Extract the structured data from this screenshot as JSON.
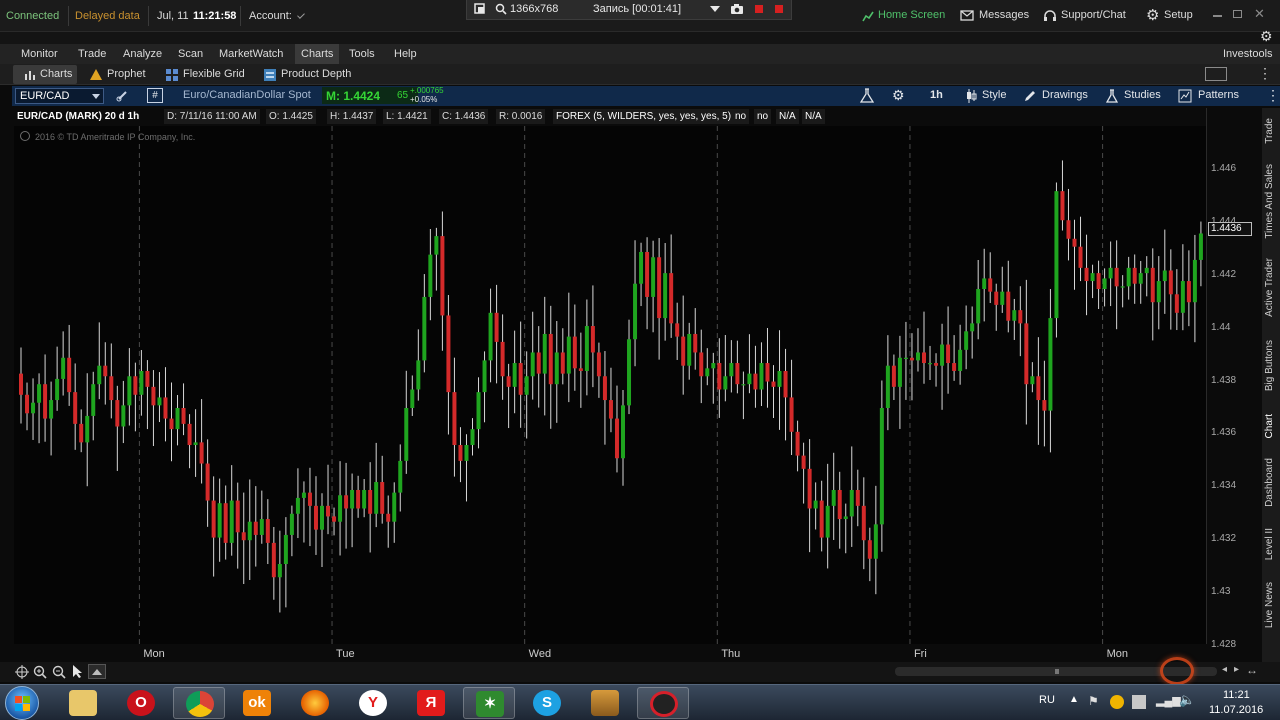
{
  "status": {
    "connected": "Connected",
    "delayed": "Delayed data",
    "date": "Jul, 11",
    "time": "11:21:58",
    "account_label": "Account:"
  },
  "recorder": {
    "resolution": "1366x768",
    "recording": "Запись [00:01:41]"
  },
  "top_right": {
    "home": "Home Screen",
    "messages": "Messages",
    "support": "Support/Chat",
    "setup": "Setup"
  },
  "menu": [
    "Monitor",
    "Trade",
    "Analyze",
    "Scan",
    "MarketWatch",
    "Charts",
    "Tools",
    "Help"
  ],
  "menu_right": "Investools",
  "subtabs": [
    "Charts",
    "Prophet",
    "Flexible Grid",
    "Product Depth"
  ],
  "chart_toolbar": {
    "symbol": "EUR/CAD",
    "description": "Euro/CanadianDollar Spot",
    "mark_label": "M: 1.4424",
    "mark_suffix": "65",
    "change": "+.000765",
    "change_pct": "+0.05%",
    "timeframe": "1h",
    "style": "Style",
    "drawings": "Drawings",
    "studies": "Studies",
    "patterns": "Patterns"
  },
  "info": {
    "title": "EUR/CAD (MARK) 20 d 1h",
    "date": "D: 7/11/16 11:00 AM",
    "open": "O: 1.4425",
    "high": "H: 1.4437",
    "low": "L: 1.4421",
    "close": "C: 1.4436",
    "range": "R: 0.0016",
    "forex": "FOREX (5, WILDERS, yes, yes, yes, 5)",
    "f1": "no",
    "f2": "no",
    "f3": "N/A",
    "f4": "N/A"
  },
  "copyright": "2016 © TD Ameritrade IP Company, Inc.",
  "last_price_tag": "1.4436",
  "colors": {
    "up": "#1fa51f",
    "down": "#d42a2a",
    "toolbar": "#10294a",
    "accent_green": "#28c828"
  },
  "side_tabs": [
    "Trade",
    "Times And Sales",
    "Active Trader",
    "Big Buttons",
    "Chart",
    "Dashboard",
    "Level II",
    "Live News"
  ],
  "system_tray": {
    "lang": "RU",
    "clock": "11:21",
    "date": "11.07.2016"
  },
  "taskbar_apps": [
    "windows-start",
    "file-explorer",
    "opera",
    "chrome",
    "ok-ru",
    "firefox",
    "yandex-browser",
    "yandex",
    "thinkorswim",
    "skype",
    "alpari",
    "screen-recorder"
  ],
  "chart_data": {
    "type": "candlestick",
    "title": "EUR/CAD (MARK) 20 d 1h",
    "ylim": [
      1.428,
      1.4475
    ],
    "y_ticks": [
      1.428,
      1.43,
      1.432,
      1.434,
      1.436,
      1.438,
      1.44,
      1.442,
      1.444,
      1.446
    ],
    "y_tick_labels": [
      "1.428",
      "1.43",
      "1.432",
      "1.434",
      "1.436",
      "1.438",
      "1.44",
      "1.442",
      "1.444",
      "1.446"
    ],
    "day_labels": [
      "Mon",
      "Tue",
      "Wed",
      "Thu",
      "Fri",
      "Mon"
    ],
    "day_label_index": [
      20,
      52,
      84,
      116,
      148,
      180
    ],
    "separator_index": [
      20,
      52,
      84,
      116,
      148,
      180
    ],
    "grid": false,
    "closes": [
      1.4375,
      1.4368,
      1.4372,
      1.4379,
      1.4366,
      1.4373,
      1.4381,
      1.4389,
      1.4376,
      1.4364,
      1.4357,
      1.4367,
      1.4379,
      1.4386,
      1.4382,
      1.4373,
      1.4363,
      1.4371,
      1.4382,
      1.4375,
      1.4384,
      1.4378,
      1.4371,
      1.4374,
      1.4366,
      1.4362,
      1.437,
      1.4364,
      1.4356,
      1.4357,
      1.4349,
      1.4335,
      1.4321,
      1.4334,
      1.4319,
      1.4335,
      1.4323,
      1.432,
      1.4327,
      1.4322,
      1.4328,
      1.4319,
      1.4306,
      1.4311,
      1.4322,
      1.433,
      1.4336,
      1.4338,
      1.4333,
      1.4324,
      1.4333,
      1.4329,
      1.4327,
      1.4337,
      1.4332,
      1.4339,
      1.4332,
      1.4339,
      1.433,
      1.4342,
      1.433,
      1.4327,
      1.4338,
      1.435,
      1.437,
      1.4377,
      1.4388,
      1.4412,
      1.4428,
      1.4435,
      1.4405,
      1.4376,
      1.4356,
      1.435,
      1.4356,
      1.4362,
      1.4376,
      1.4388,
      1.4406,
      1.4395,
      1.4382,
      1.4378,
      1.4387,
      1.4375,
      1.4382,
      1.4391,
      1.4383,
      1.4398,
      1.4379,
      1.4391,
      1.4383,
      1.4397,
      1.4385,
      1.4384,
      1.4401,
      1.4391,
      1.4382,
      1.4373,
      1.4366,
      1.4351,
      1.4371,
      1.4396,
      1.4417,
      1.4429,
      1.4412,
      1.4427,
      1.4404,
      1.4421,
      1.4402,
      1.4397,
      1.4386,
      1.4398,
      1.4391,
      1.4382,
      1.4385,
      1.4387,
      1.4377,
      1.4382,
      1.4387,
      1.4379,
      1.4379,
      1.4383,
      1.4377,
      1.4387,
      1.438,
      1.4378,
      1.4384,
      1.4374,
      1.4361,
      1.4352,
      1.4347,
      1.4332,
      1.4335,
      1.4321,
      1.4333,
      1.4339,
      1.4328,
      1.4329,
      1.4339,
      1.4333,
      1.432,
      1.4313,
      1.4326,
      1.437,
      1.4386,
      1.4378,
      1.4389,
      1.4389,
      1.4388,
      1.4391,
      1.4387,
      1.4387,
      1.4386,
      1.4394,
      1.4387,
      1.4384,
      1.4392,
      1.4399,
      1.4402,
      1.4415,
      1.4419,
      1.4414,
      1.4409,
      1.4414,
      1.4403,
      1.4407,
      1.4402,
      1.4379,
      1.4382,
      1.4373,
      1.4369,
      1.4404,
      1.4452,
      1.4441,
      1.4434,
      1.4431,
      1.4423,
      1.4418,
      1.4421,
      1.4415,
      1.4419,
      1.4423,
      1.4416,
      1.4416,
      1.4423,
      1.4417,
      1.4421,
      1.4423,
      1.441,
      1.4418,
      1.4422,
      1.4413,
      1.4406,
      1.4418,
      1.441,
      1.4426,
      1.4436
    ]
  }
}
